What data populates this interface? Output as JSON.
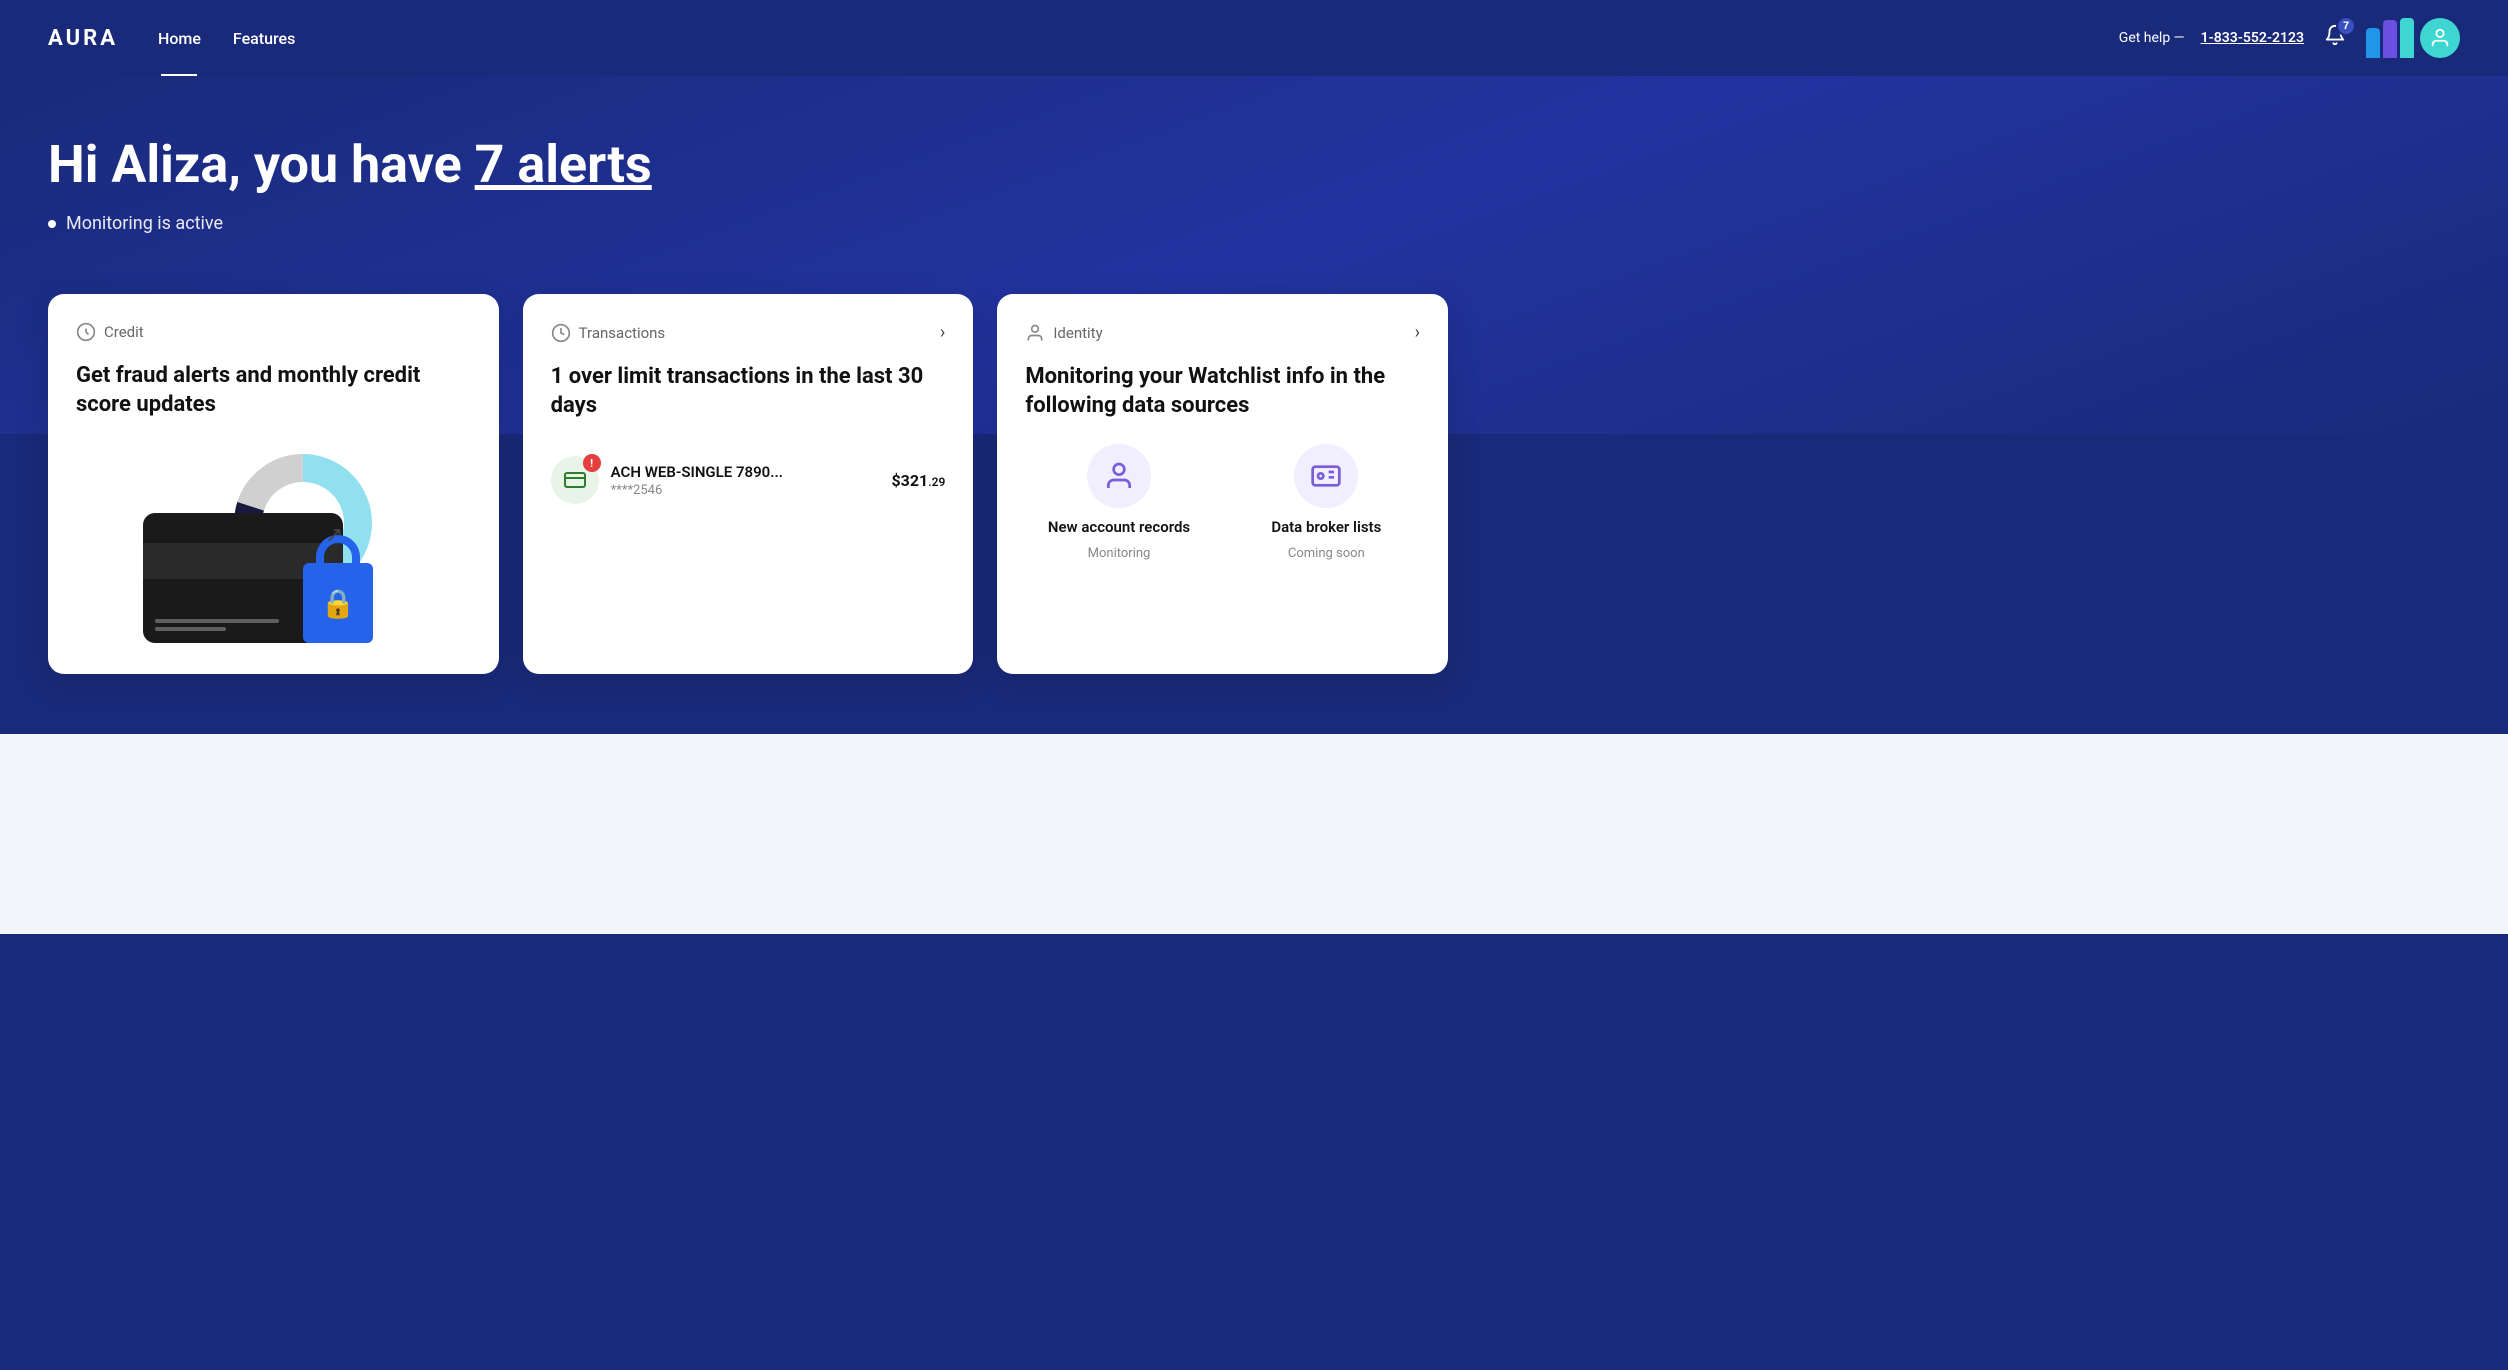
{
  "nav": {
    "logo": "AURA",
    "links": [
      {
        "label": "Home",
        "active": true
      },
      {
        "label": "Features",
        "active": false
      }
    ],
    "help_text": "Get help —",
    "phone": "1-833-552-2123",
    "alert_count": "7"
  },
  "hero": {
    "greeting": "Hi Aliza, you have ",
    "alerts_link": "7 alerts",
    "monitoring_status": "Monitoring is active"
  },
  "cards": {
    "credit": {
      "category": "Credit",
      "title": "Get fraud alerts and monthly credit score updates",
      "donut": {
        "segments": [
          {
            "color": "#90e0ef",
            "pct": 60
          },
          {
            "color": "#1a1a2e",
            "pct": 20
          },
          {
            "color": "#e0e0e0",
            "pct": 20
          }
        ]
      }
    },
    "transactions": {
      "category": "Transactions",
      "title": "1 over limit transactions in the last 30 days",
      "transaction": {
        "name": "ACH WEB-SINGLE 7890...",
        "account": "****2546",
        "amount": "$321",
        "cents": ".29",
        "has_alert": true
      }
    },
    "identity": {
      "category": "Identity",
      "title": "Monitoring your Watchlist info in the following data sources",
      "sources": [
        {
          "name": "New account records",
          "status": "Monitoring",
          "icon": "person"
        },
        {
          "name": "Data broker lists",
          "status": "Coming soon",
          "icon": "id-card"
        }
      ]
    }
  }
}
